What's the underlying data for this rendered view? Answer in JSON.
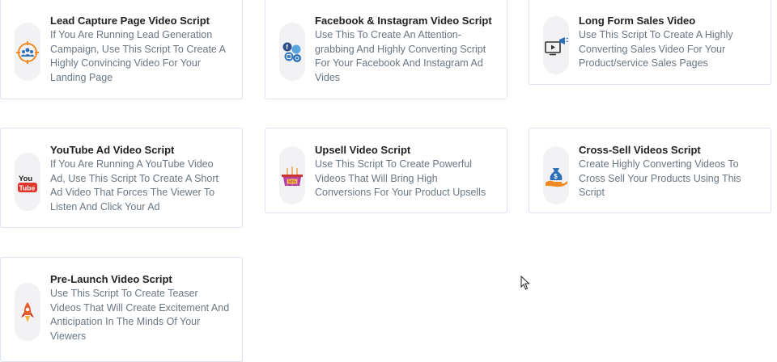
{
  "cards": [
    {
      "title": "Lead Capture Page Video Script",
      "description": "If You Are Running Lead Generation Campaign, Use This Script To Create A Highly Convincing Video For Your Landing Page",
      "icon": "lead-capture-icon"
    },
    {
      "title": "Facebook & Instagram Video Script",
      "description": "Use This To Create An Attention-grabbing And Highly Converting Script For Your Facebook And Instagram Ad Vides",
      "icon": "social-media-icon"
    },
    {
      "title": "Long Form Sales Video",
      "description": "Use This Script To Create A Highly Converting Sales Video For Your Product/service Sales Pages",
      "icon": "video-megaphone-icon"
    },
    {
      "title": "YouTube Ad Video Script",
      "description": "If You Are Running A YouTube Video Ad, Use This Script To Create A Short Ad Video That Forces The Viewer To Listen And Click Your Ad",
      "icon": "youtube-icon",
      "icon_text_top": "You",
      "icon_text_bottom": "Tube"
    },
    {
      "title": "Upsell Video Script",
      "description": "Use This Script To Create Powerful Videos That Will Bring High Conversions For Your Product Upsells",
      "icon": "shopping-basket-icon",
      "icon_text": "50%"
    },
    {
      "title": "Cross-Sell Videos Script",
      "description": "Create Highly Converting Videos To Cross Sell Your Products Using This Script",
      "icon": "money-bag-hand-icon",
      "icon_text": "$"
    },
    {
      "title": "Pre-Launch Video Script",
      "description": "Use This Script To Create Teaser Videos That Will Create Excitement And Anticipation In The Minds Of Your Viewers",
      "icon": "rocket-icon"
    }
  ],
  "colors": {
    "border": "#dbe3ee",
    "title": "#222222",
    "description": "#6a7682",
    "icon_bg": "#f2f2f4",
    "accent_orange": "#f08a24",
    "accent_blue": "#2d6fb7",
    "youtube_red": "#e0362b"
  }
}
